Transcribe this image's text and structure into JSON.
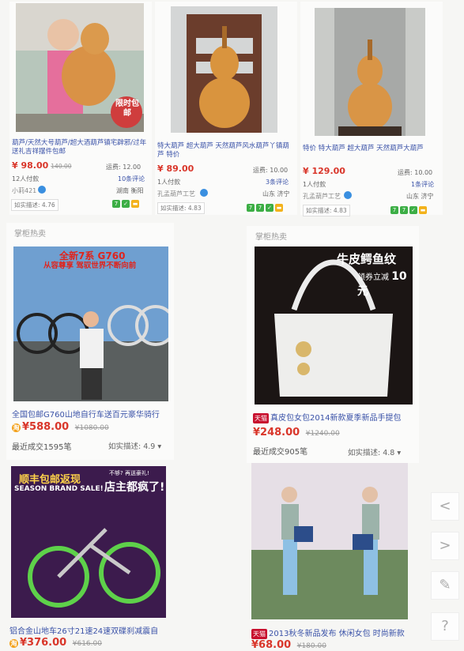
{
  "top_products": [
    {
      "title": "葫芦/天然大号葫芦/超大酒葫芦镇宅辟邪/过年送礼吉祥摆件包邮",
      "price": "¥ 98.00",
      "old_price": "140.00",
      "shipping": "运费: 12.00",
      "sold": "12人付款",
      "reviews": "10条评论",
      "shop": "小莉421",
      "location": "湖南 衡阳",
      "rating": "如实描述: 4.76",
      "promo": "限时包邮"
    },
    {
      "title": "特大葫芦 超大葫芦 天然葫芦风水葫芦丫镇葫芦 特价",
      "price": "¥ 89.00",
      "shipping": "运费: 10.00",
      "sold": "1人付款",
      "reviews": "3条评论",
      "shop": "孔孟葫芦工艺",
      "location": "山东 济宁",
      "rating": "如实描述: 4.83"
    },
    {
      "title": "特价 特大葫芦 超大葫芦 天然葫芦大葫芦",
      "price": "¥ 129.00",
      "shipping": "运费: 10.00",
      "sold": "1人付款",
      "reviews": "1条评论",
      "shop": "孔孟葫芦工艺",
      "location": "山东 济宁",
      "rating": "如实描述: 4.83"
    }
  ],
  "section_label": "掌柜热卖",
  "big_products": [
    {
      "banner": "全新7系 G760",
      "banner_sub": "从容尊享 驾驭世界不断向前",
      "title": "全国包邮G760山地自行车送百元豪华骑行",
      "price": "588.00",
      "old_price": "1080.00",
      "sold": "最近成交1595笔",
      "rating": "如实描述: 4.9"
    },
    {
      "banner": "牛皮鳄鱼纹",
      "banner_sub": "领券立减",
      "banner_amount": "10元",
      "tag": "天猫",
      "title": "真皮包女包2014新款夏季新品手提包",
      "price": "248.00",
      "old_price": "1240.00",
      "sold": "最近成交905笔",
      "rating": "如实描述: 4.8"
    },
    {
      "banner": "顺丰包邮返现",
      "banner_en": "SEASON BRAND SALE!",
      "banner_sub": "店主都疯了!",
      "banner_note": "不够? 再送豪礼!",
      "title": "铝合金山地车26寸21速24速双碟刹减震自",
      "price": "376.00",
      "old_price": "616.00"
    },
    {
      "tag": "天猫",
      "title": "2013秋冬新品发布 休闲女包 时尚新款",
      "price": "68.00",
      "old_price": "180.00"
    }
  ],
  "side_buttons": [
    "<",
    ">",
    "✎",
    "?"
  ],
  "colors": {
    "price": "#d9362a",
    "link": "#3a52a8",
    "tmall": "#c8102e"
  }
}
